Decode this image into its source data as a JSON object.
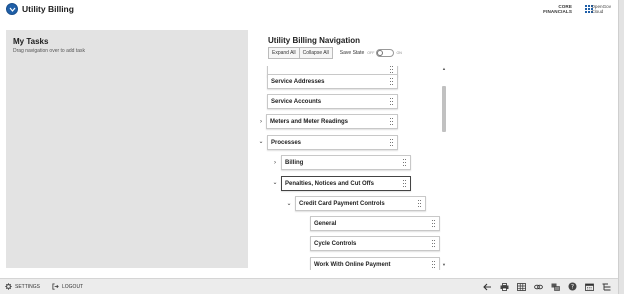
{
  "header": {
    "title": "Utility Billing",
    "product_line1": "CORE",
    "product_line2": "FINANCIALS",
    "brand_line1": "OpenGov",
    "brand_line2": "Cloud"
  },
  "tasks": {
    "title": "My Tasks",
    "hint": "Drag navigation over to add task"
  },
  "nav": {
    "title": "Utility Billing Navigation",
    "expand_all": "Expand All",
    "collapse_all": "Collapse All",
    "save_state": "Save State",
    "toggle_off": "OFF",
    "toggle_on": "ON",
    "items": [
      {
        "label": "Service Addresses"
      },
      {
        "label": "Service Accounts"
      },
      {
        "label": "Meters and Meter Readings",
        "chevron": "collapsed"
      },
      {
        "label": "Processes",
        "chevron": "expanded"
      },
      {
        "label": "Billing",
        "chevron": "collapsed"
      },
      {
        "label": "Penalties, Notices and Cut Offs",
        "chevron": "expanded",
        "selected": true
      },
      {
        "label": "Credit Card Payment Controls",
        "chevron": "expanded"
      },
      {
        "label": "General"
      },
      {
        "label": "Cycle Controls"
      },
      {
        "label": "Work With Online Payment"
      }
    ]
  },
  "footer": {
    "settings": "SETTINGS",
    "logout": "LOGOUT",
    "tools": [
      "back-arrow-icon",
      "print-icon",
      "grid-icon",
      "link-icon",
      "layers-icon",
      "help-icon",
      "calendar-icon",
      "tree-icon"
    ]
  },
  "colors": {
    "accent": "#1f5fa8",
    "panel": "#e3e3e3"
  }
}
